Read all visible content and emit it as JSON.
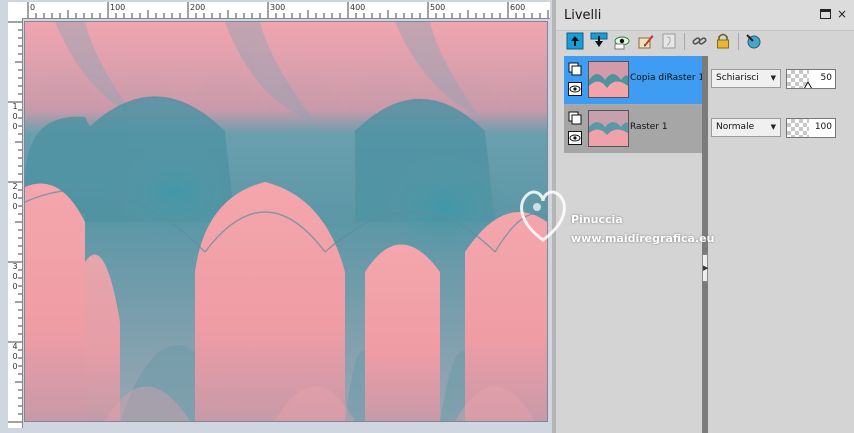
{
  "canvas": {
    "ruler_top_labels": [
      "0",
      "100",
      "200",
      "300",
      "400",
      "500",
      "600"
    ],
    "ruler_left_labels": [
      "1\n0\n0",
      "2\n0\n0",
      "3\n0\n0",
      "4\n0\n0"
    ],
    "colors": {
      "pink": "#f3a3aa",
      "teal": "#4f93a3",
      "slate": "#8c9eae"
    }
  },
  "panel": {
    "title": "Livelli",
    "toolbar_icons": [
      "new-raster-layer-icon",
      "merge-down-icon",
      "visibility-toggle-icon",
      "paint-brush-icon",
      "mask-icon",
      "link-icon",
      "lock-icon",
      "layer-properties-icon"
    ]
  },
  "layers": [
    {
      "name": "Copia diRaster 1",
      "blend_mode": "Schiarisci",
      "opacity": "50",
      "selected": true
    },
    {
      "name": "Raster 1",
      "blend_mode": "Normale",
      "opacity": "100",
      "selected": false
    }
  ],
  "watermark": {
    "name": "Pinuccia",
    "site": "www.maidiregrafica.eu"
  },
  "accent_colors": {
    "selection": "#3e9cf2",
    "toolbar_blue": "#1a9cd8"
  }
}
